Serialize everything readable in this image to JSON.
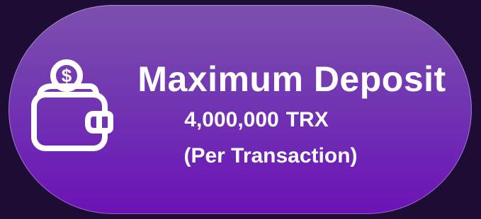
{
  "card": {
    "icon": "wallet-coin-icon",
    "title": "Maximum Deposit",
    "amount": "4,000,000",
    "currency": "TRX",
    "note": "(Per Transaction)"
  },
  "colors": {
    "background": "#1d0c33",
    "pill_top": "#7c50ad",
    "pill_bottom": "#6b12b6",
    "text": "#ffffff"
  }
}
